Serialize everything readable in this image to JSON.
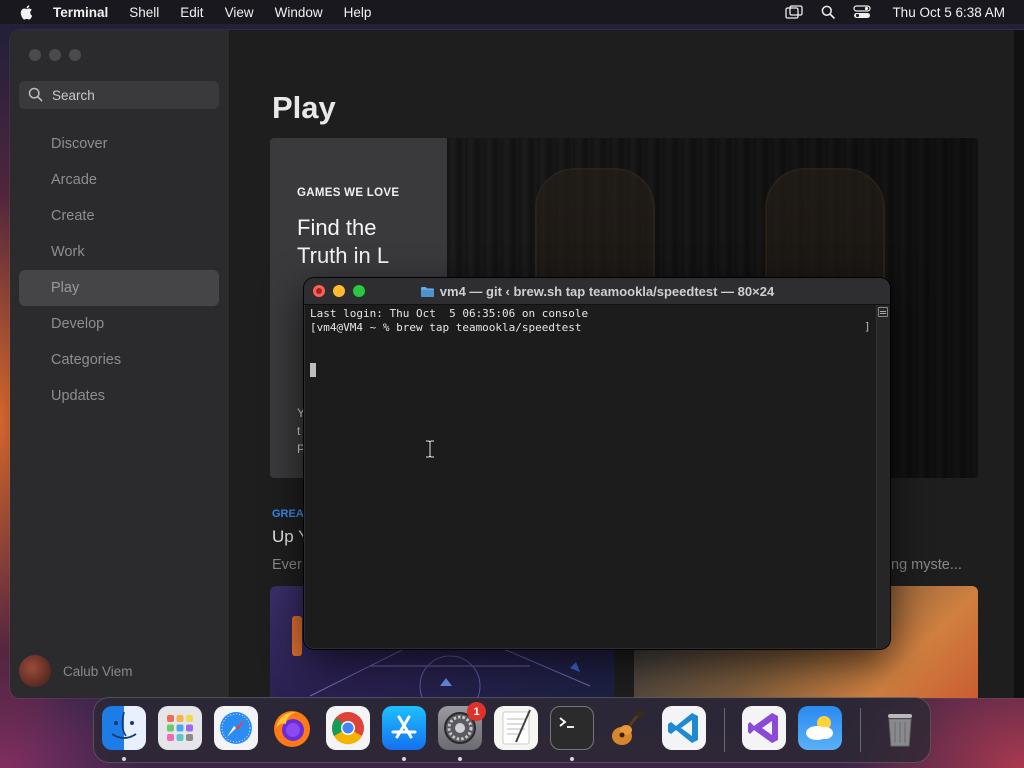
{
  "menubar": {
    "app_name": "Terminal",
    "items": [
      "Shell",
      "Edit",
      "View",
      "Window",
      "Help"
    ],
    "clock": "Thu Oct 5  6:38 AM",
    "status_icons": [
      "window-manager-icon",
      "search-icon",
      "control-center-icon"
    ]
  },
  "store": {
    "search_placeholder": "Search",
    "nav": [
      {
        "label": "Discover",
        "active": false
      },
      {
        "label": "Arcade",
        "active": false
      },
      {
        "label": "Create",
        "active": false
      },
      {
        "label": "Work",
        "active": false
      },
      {
        "label": "Play",
        "active": true
      },
      {
        "label": "Develop",
        "active": false
      },
      {
        "label": "Categories",
        "active": false
      },
      {
        "label": "Updates",
        "active": false
      }
    ],
    "user_name": "Calub Viem",
    "page_title": "Play",
    "feature": {
      "eyebrow": "GAMES WE LOVE",
      "headline": "Find the Truth in L",
      "body": "Y\nt\nP"
    },
    "section": {
      "eyebrow": "GREAT",
      "title": "Up Y",
      "subtitle": "Ever",
      "right_subtitle": "ng myste..."
    }
  },
  "terminal": {
    "title": "vm4 — git ‹ brew.sh tap teamookla/speedtest — 80×24",
    "lines": [
      "Last login: Thu Oct  5 06:35:06 on console",
      "[vm4@VM4 ~ % brew tap teamookla/speedtest"
    ],
    "right_bracket": "]"
  },
  "dock": {
    "apps": [
      {
        "name": "Finder",
        "icon": "finder-icon",
        "running": true
      },
      {
        "name": "Launchpad",
        "icon": "launchpad-icon",
        "running": false
      },
      {
        "name": "Safari",
        "icon": "safari-icon",
        "running": false
      },
      {
        "name": "Firefox",
        "icon": "firefox-icon",
        "running": false
      },
      {
        "name": "Chrome",
        "icon": "chrome-icon",
        "running": false
      },
      {
        "name": "App Store",
        "icon": "app-store-icon",
        "running": true
      },
      {
        "name": "System Settings",
        "icon": "system-settings-icon",
        "running": true,
        "badge": "1"
      },
      {
        "name": "TextEdit",
        "icon": "textedit-icon",
        "running": false
      },
      {
        "name": "Terminal",
        "icon": "terminal-icon",
        "running": true
      },
      {
        "name": "GarageBand",
        "icon": "garageband-icon",
        "running": false
      },
      {
        "name": "VS Code",
        "icon": "vscode-icon",
        "running": false
      },
      {
        "name": "Visual Studio",
        "icon": "visual-studio-icon",
        "running": false
      },
      {
        "name": "Weather",
        "icon": "weather-icon",
        "running": false
      },
      {
        "name": "Trash",
        "icon": "trash-icon",
        "running": false
      }
    ],
    "badge_count": "1"
  }
}
